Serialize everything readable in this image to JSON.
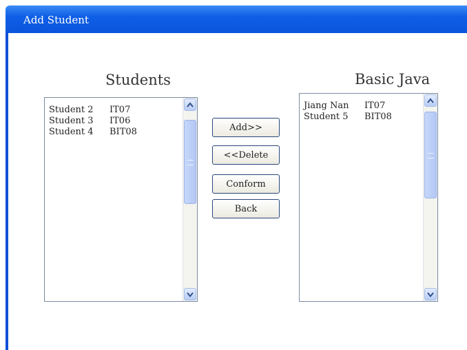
{
  "window": {
    "title": "Add Student"
  },
  "left_panel": {
    "heading": "Students",
    "rows": [
      {
        "name": "Student 2",
        "class": "IT07"
      },
      {
        "name": "Student 3",
        "class": "IT06"
      },
      {
        "name": "Student 4",
        "class": "BIT08"
      }
    ]
  },
  "right_panel": {
    "heading": "Basic Java",
    "rows": [
      {
        "name": "Jiang Nan",
        "class": "IT07"
      },
      {
        "name": "Student 5",
        "class": "BIT08"
      }
    ]
  },
  "buttons": {
    "add": "Add>>",
    "delete": "<<Delete",
    "conform": "Conform",
    "back": "Back"
  },
  "icons": {
    "scroll_up": "chevron-up-icon",
    "scroll_down": "chevron-down-icon",
    "scroll_grip": "grip-icon"
  },
  "colors": {
    "titlebar": "#0a55dc",
    "window_border": "#0a50d8",
    "button_border": "#28467a",
    "scrollbar_thumb": "#b3c8f4"
  }
}
